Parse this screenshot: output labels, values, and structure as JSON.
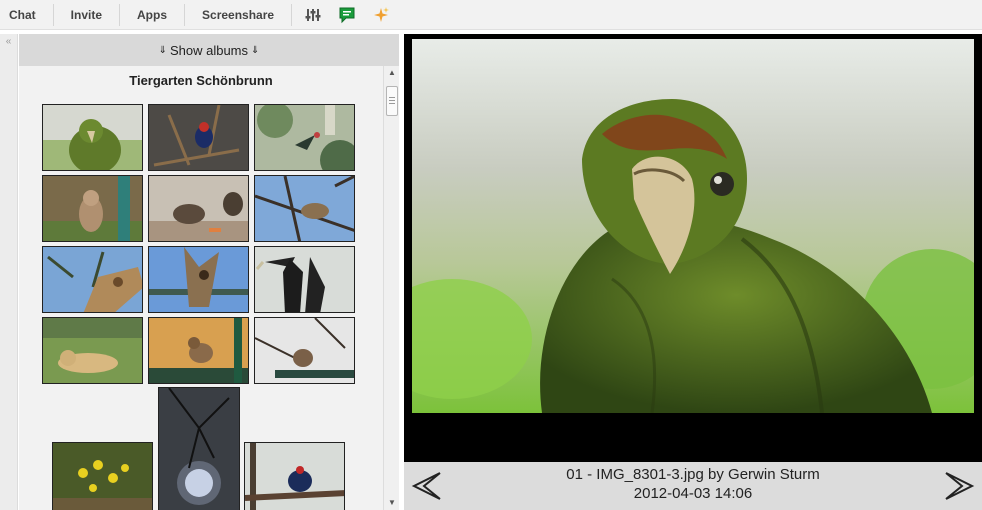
{
  "toolbar": {
    "items": [
      "Chat",
      "Invite",
      "Apps",
      "Screenshare"
    ],
    "icons": [
      "equalizer-icon",
      "chat-bubble-icon",
      "sparkle-icon"
    ],
    "chat_icon_color": "#1a9c3b",
    "sparkle_color": "#f0a030"
  },
  "album": {
    "toggle_label": "Show albums",
    "title": "Tiergarten Schönbrunn"
  },
  "viewer": {
    "caption_line1": "01 - IMG_8301-3.jpg by Gerwin Sturm",
    "caption_line2": "2012-04-03 14:06"
  },
  "colors": {
    "toolbar_bg": "#f2f2f2",
    "panel_bg": "#f0f0f0",
    "header_bg": "#d9d9d9",
    "viewer_bg": "#000000",
    "caption_bg": "#dcdcdc"
  }
}
